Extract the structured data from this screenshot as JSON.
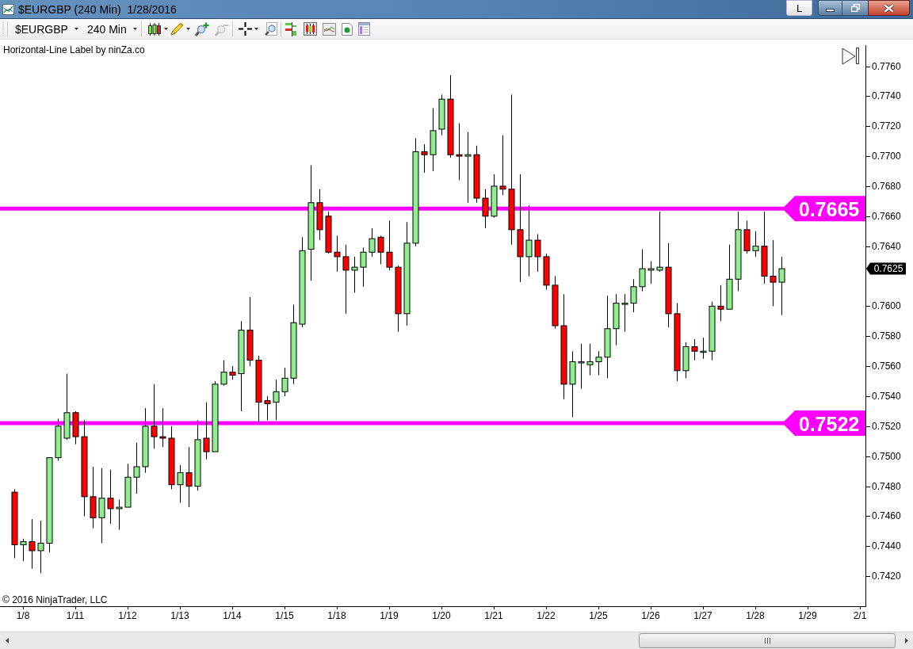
{
  "window": {
    "title": "$EURGBP (240 Min)  1/28/2016",
    "l_button": "L"
  },
  "toolbar": {
    "instrument": "$EURGBP",
    "interval": "240 Min",
    "tools": [
      {
        "kind": "chart_style",
        "disabled": false
      },
      {
        "kind": "draw",
        "disabled": false
      },
      {
        "kind": "zoom_in",
        "disabled": false
      },
      {
        "kind": "zoom_out",
        "disabled": true
      },
      {
        "kind": "crosshair",
        "disabled": false
      },
      {
        "kind": "zoom_box",
        "disabled": false
      },
      {
        "kind": "bars",
        "disabled": false
      },
      {
        "kind": "candles",
        "disabled": false
      },
      {
        "kind": "line_chart",
        "disabled": false
      },
      {
        "kind": "document",
        "disabled": false
      },
      {
        "kind": "table",
        "disabled": false
      }
    ]
  },
  "chart": {
    "indicator_label": "Horizontal-Line Label by ninZa.co",
    "copyright": "© 2016 NinjaTrader, LLC",
    "last_price_label": "0.7625",
    "chart_data": {
      "type": "candlestick",
      "ylim": [
        0.74,
        0.7774
      ],
      "categories": [
        null,
        "1/8",
        null,
        null,
        null,
        null,
        null,
        "1/11",
        null,
        null,
        null,
        null,
        null,
        "1/12",
        null,
        null,
        null,
        null,
        null,
        "1/13",
        null,
        null,
        null,
        null,
        null,
        "1/14",
        null,
        null,
        null,
        null,
        null,
        "1/15",
        null,
        null,
        null,
        null,
        null,
        "1/18",
        null,
        null,
        null,
        null,
        null,
        "1/19",
        null,
        null,
        null,
        null,
        null,
        "1/20",
        null,
        null,
        null,
        null,
        null,
        "1/21",
        null,
        null,
        null,
        null,
        null,
        "1/22",
        null,
        null,
        null,
        null,
        null,
        "1/25",
        null,
        null,
        null,
        null,
        null,
        "1/26",
        null,
        null,
        null,
        null,
        null,
        "1/27",
        null,
        null,
        null,
        null,
        null,
        "1/28",
        null,
        null,
        null,
        null,
        null,
        "1/29",
        null,
        null,
        null,
        null,
        null,
        "2/1"
      ],
      "yticks": [
        {
          "value": 0.776,
          "label": "0.7760"
        },
        {
          "value": 0.774,
          "label": "0.7740"
        },
        {
          "value": 0.772,
          "label": "0.7720"
        },
        {
          "value": 0.77,
          "label": "0.7700"
        },
        {
          "value": 0.768,
          "label": "0.7680"
        },
        {
          "value": 0.766,
          "label": "0.7660"
        },
        {
          "value": 0.764,
          "label": "0.7640"
        },
        {
          "value": 0.76,
          "label": "0.7600"
        },
        {
          "value": 0.758,
          "label": "0.7580"
        },
        {
          "value": 0.756,
          "label": "0.7560"
        },
        {
          "value": 0.754,
          "label": "0.7540"
        },
        {
          "value": 0.752,
          "label": "0.7520"
        },
        {
          "value": 0.75,
          "label": "0.7500"
        },
        {
          "value": 0.748,
          "label": "0.7480"
        },
        {
          "value": 0.746,
          "label": "0.7460"
        },
        {
          "value": 0.744,
          "label": "0.7440"
        },
        {
          "value": 0.742,
          "label": "0.7420"
        }
      ],
      "ohlc": [
        [
          0.7476,
          0.7478,
          0.7432,
          0.7441
        ],
        [
          0.7441,
          0.7445,
          0.743,
          0.7443
        ],
        [
          0.7443,
          0.7458,
          0.7425,
          0.7437
        ],
        [
          0.7437,
          0.7457,
          0.7422,
          0.7442
        ],
        [
          0.7442,
          0.7499,
          0.7436,
          0.7499
        ],
        [
          0.7499,
          0.7525,
          0.7497,
          0.752
        ],
        [
          0.7512,
          0.7555,
          0.7511,
          0.7529
        ],
        [
          0.7529,
          0.753,
          0.7508,
          0.7513
        ],
        [
          0.7513,
          0.7524,
          0.746,
          0.7473
        ],
        [
          0.7473,
          0.7493,
          0.7452,
          0.7459
        ],
        [
          0.7459,
          0.7492,
          0.7442,
          0.7472
        ],
        [
          0.7472,
          0.7491,
          0.7455,
          0.7465
        ],
        [
          0.7465,
          0.7471,
          0.7451,
          0.7466
        ],
        [
          0.7466,
          0.7495,
          0.7466,
          0.7486
        ],
        [
          0.7486,
          0.7509,
          0.7475,
          0.7493
        ],
        [
          0.7493,
          0.7532,
          0.7489,
          0.752
        ],
        [
          0.752,
          0.7548,
          0.7505,
          0.7513
        ],
        [
          0.7513,
          0.7532,
          0.7506,
          0.7512
        ],
        [
          0.7512,
          0.752,
          0.7478,
          0.7481
        ],
        [
          0.7481,
          0.7494,
          0.7469,
          0.7489
        ],
        [
          0.7489,
          0.7506,
          0.7466,
          0.748
        ],
        [
          0.748,
          0.7524,
          0.7477,
          0.7511
        ],
        [
          0.7512,
          0.7536,
          0.7498,
          0.7503
        ],
        [
          0.7503,
          0.755,
          0.7503,
          0.7548
        ],
        [
          0.7548,
          0.7564,
          0.7547,
          0.7556
        ],
        [
          0.7556,
          0.756,
          0.7551,
          0.7554
        ],
        [
          0.7555,
          0.759,
          0.753,
          0.7584
        ],
        [
          0.7584,
          0.7606,
          0.756,
          0.7564
        ],
        [
          0.7564,
          0.7567,
          0.7523,
          0.7536
        ],
        [
          0.7537,
          0.754,
          0.7524,
          0.7535
        ],
        [
          0.7536,
          0.7551,
          0.7524,
          0.7543
        ],
        [
          0.7543,
          0.7559,
          0.754,
          0.7552
        ],
        [
          0.7552,
          0.7601,
          0.7548,
          0.7589
        ],
        [
          0.7588,
          0.7646,
          0.7586,
          0.7637
        ],
        [
          0.7638,
          0.7694,
          0.7617,
          0.7669
        ],
        [
          0.7669,
          0.7678,
          0.7644,
          0.7651
        ],
        [
          0.766,
          0.7663,
          0.7635,
          0.7636
        ],
        [
          0.7636,
          0.7647,
          0.7623,
          0.7633
        ],
        [
          0.7633,
          0.7641,
          0.7595,
          0.7624
        ],
        [
          0.7624,
          0.7633,
          0.7609,
          0.7626
        ],
        [
          0.7626,
          0.7639,
          0.7613,
          0.7636
        ],
        [
          0.7636,
          0.7652,
          0.7633,
          0.7645
        ],
        [
          0.7646,
          0.7647,
          0.7628,
          0.7636
        ],
        [
          0.7636,
          0.7657,
          0.7624,
          0.7626
        ],
        [
          0.7626,
          0.7627,
          0.7583,
          0.7595
        ],
        [
          0.7595,
          0.7656,
          0.7587,
          0.7642
        ],
        [
          0.7642,
          0.7712,
          0.764,
          0.7703
        ],
        [
          0.7703,
          0.7708,
          0.7689,
          0.7701
        ],
        [
          0.7701,
          0.7732,
          0.769,
          0.7717
        ],
        [
          0.7718,
          0.7741,
          0.7714,
          0.7738
        ],
        [
          0.7738,
          0.7754,
          0.7699,
          0.7701
        ],
        [
          0.7701,
          0.7722,
          0.7684,
          0.77
        ],
        [
          0.77,
          0.7716,
          0.7669,
          0.7701
        ],
        [
          0.7701,
          0.7707,
          0.7669,
          0.7672
        ],
        [
          0.7672,
          0.7678,
          0.7652,
          0.766
        ],
        [
          0.766,
          0.7688,
          0.7659,
          0.768
        ],
        [
          0.768,
          0.7714,
          0.7674,
          0.7678
        ],
        [
          0.7678,
          0.7741,
          0.7641,
          0.7651
        ],
        [
          0.7651,
          0.7688,
          0.7616,
          0.7633
        ],
        [
          0.7633,
          0.7667,
          0.762,
          0.7644
        ],
        [
          0.7644,
          0.7648,
          0.7623,
          0.7633
        ],
        [
          0.7633,
          0.7635,
          0.7611,
          0.7614
        ],
        [
          0.7614,
          0.762,
          0.7585,
          0.7587
        ],
        [
          0.7587,
          0.7608,
          0.7538,
          0.7548
        ],
        [
          0.7548,
          0.757,
          0.7526,
          0.7563
        ],
        [
          0.7563,
          0.7575,
          0.7545,
          0.7563
        ],
        [
          0.7561,
          0.7575,
          0.7554,
          0.7563
        ],
        [
          0.7563,
          0.757,
          0.7554,
          0.7566
        ],
        [
          0.7566,
          0.7607,
          0.7552,
          0.7585
        ],
        [
          0.7585,
          0.7608,
          0.7574,
          0.7602
        ],
        [
          0.7602,
          0.7608,
          0.7583,
          0.7602
        ],
        [
          0.7602,
          0.7618,
          0.7596,
          0.7613
        ],
        [
          0.7613,
          0.7638,
          0.761,
          0.7625
        ],
        [
          0.7624,
          0.763,
          0.7615,
          0.7625
        ],
        [
          0.7624,
          0.7663,
          0.7623,
          0.7626
        ],
        [
          0.7626,
          0.7642,
          0.7586,
          0.7595
        ],
        [
          0.7595,
          0.7602,
          0.755,
          0.7557
        ],
        [
          0.7557,
          0.7576,
          0.7552,
          0.7573
        ],
        [
          0.7573,
          0.7578,
          0.7564,
          0.757
        ],
        [
          0.757,
          0.7579,
          0.7565,
          0.757
        ],
        [
          0.757,
          0.7603,
          0.7564,
          0.76
        ],
        [
          0.76,
          0.7614,
          0.759,
          0.7598
        ],
        [
          0.7598,
          0.7641,
          0.7598,
          0.7618
        ],
        [
          0.7618,
          0.7663,
          0.761,
          0.7651
        ],
        [
          0.7651,
          0.7657,
          0.7635,
          0.7637
        ],
        [
          0.7637,
          0.765,
          0.7633,
          0.764
        ],
        [
          0.764,
          0.7663,
          0.7615,
          0.762
        ],
        [
          0.762,
          0.7644,
          0.76,
          0.7616
        ],
        [
          0.7616,
          0.7633,
          0.7594,
          0.7625
        ],
        null,
        null,
        null,
        null,
        null,
        null,
        null,
        null,
        null
      ],
      "ref_lines": [
        {
          "axis": "y",
          "value": 0.7665,
          "label": "0.7665"
        },
        {
          "axis": "y",
          "value": 0.7522,
          "label": "0.7522"
        }
      ]
    }
  }
}
